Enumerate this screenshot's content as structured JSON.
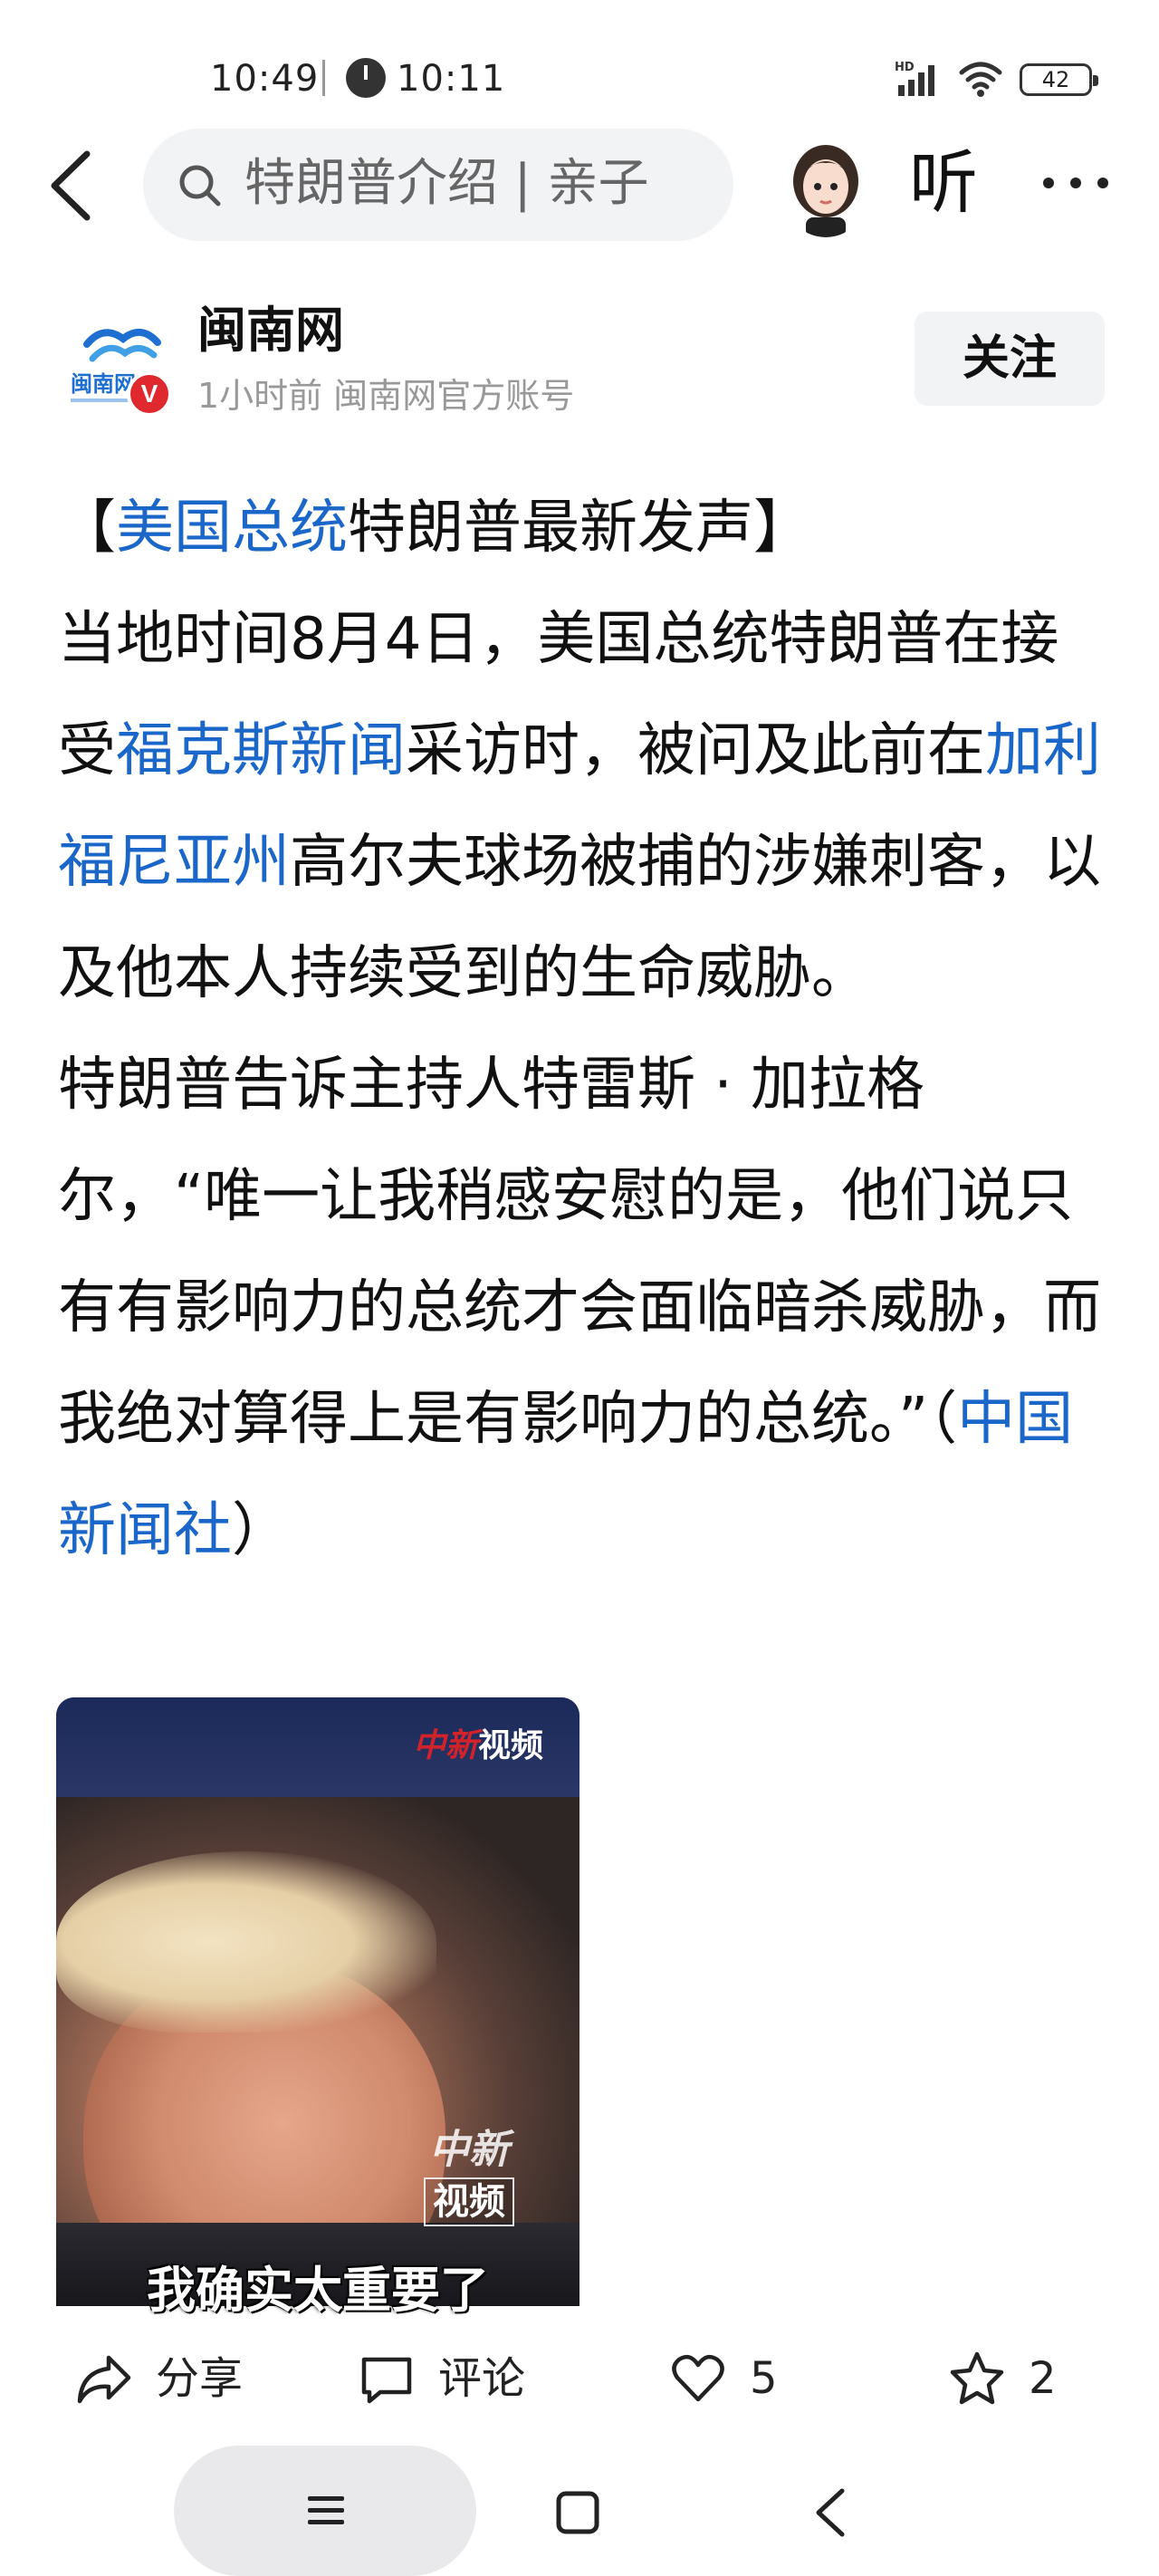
{
  "status_bar": {
    "time": "10:49",
    "secondary_time": "10:11",
    "battery_level": "42",
    "network_label": "HD"
  },
  "top_nav": {
    "search_text": "特朗普介绍 | 亲子",
    "listen_label": "听"
  },
  "account": {
    "name": "闽南网",
    "meta": "1小时前  闽南网官方账号",
    "verified_mark": "V",
    "follow_label": "关注",
    "logo_text": "闽南网"
  },
  "article": {
    "p1": {
      "bracket_open": "【",
      "link1": "美国总统",
      "t1": "特朗普最新发声",
      "bracket_close": "】"
    },
    "p2": {
      "t1": "当地时间8月4日，美国总统特朗普在接受",
      "link1": "福克斯新闻",
      "t2": "采访时，被问及此前在",
      "link2": "加利福尼亚州",
      "t3": "高尔夫球场被捕的涉嫌刺客，以及他本人持续受到的生命威胁。"
    },
    "p3": {
      "t1": "特朗普告诉主持人特雷斯 · 加拉格尔，“唯一让我稍感安慰的是，他们说只有有影响力的总统才会面临暗杀威胁，而我绝对算得上是有影响力的总统。”（",
      "link1": "中国新闻社",
      "t2": "）"
    }
  },
  "video": {
    "logo_red": "中新",
    "logo_white": "视频",
    "watermark_top": "中新",
    "watermark_bottom": "视频",
    "subtitle": "我确实太重要了"
  },
  "actions": {
    "share": "分享",
    "comment": "评论",
    "like_count": "5",
    "favorite_count": "2"
  },
  "icons": {
    "back": "back-arrow-icon",
    "search": "search-icon",
    "more": "more-dots-icon",
    "share": "share-icon",
    "comment": "comment-icon",
    "like": "heart-icon",
    "favorite": "star-icon"
  },
  "colors": {
    "link": "#1a66c9",
    "verified": "#e0282f",
    "logo_blue": "#1e6fd0"
  }
}
